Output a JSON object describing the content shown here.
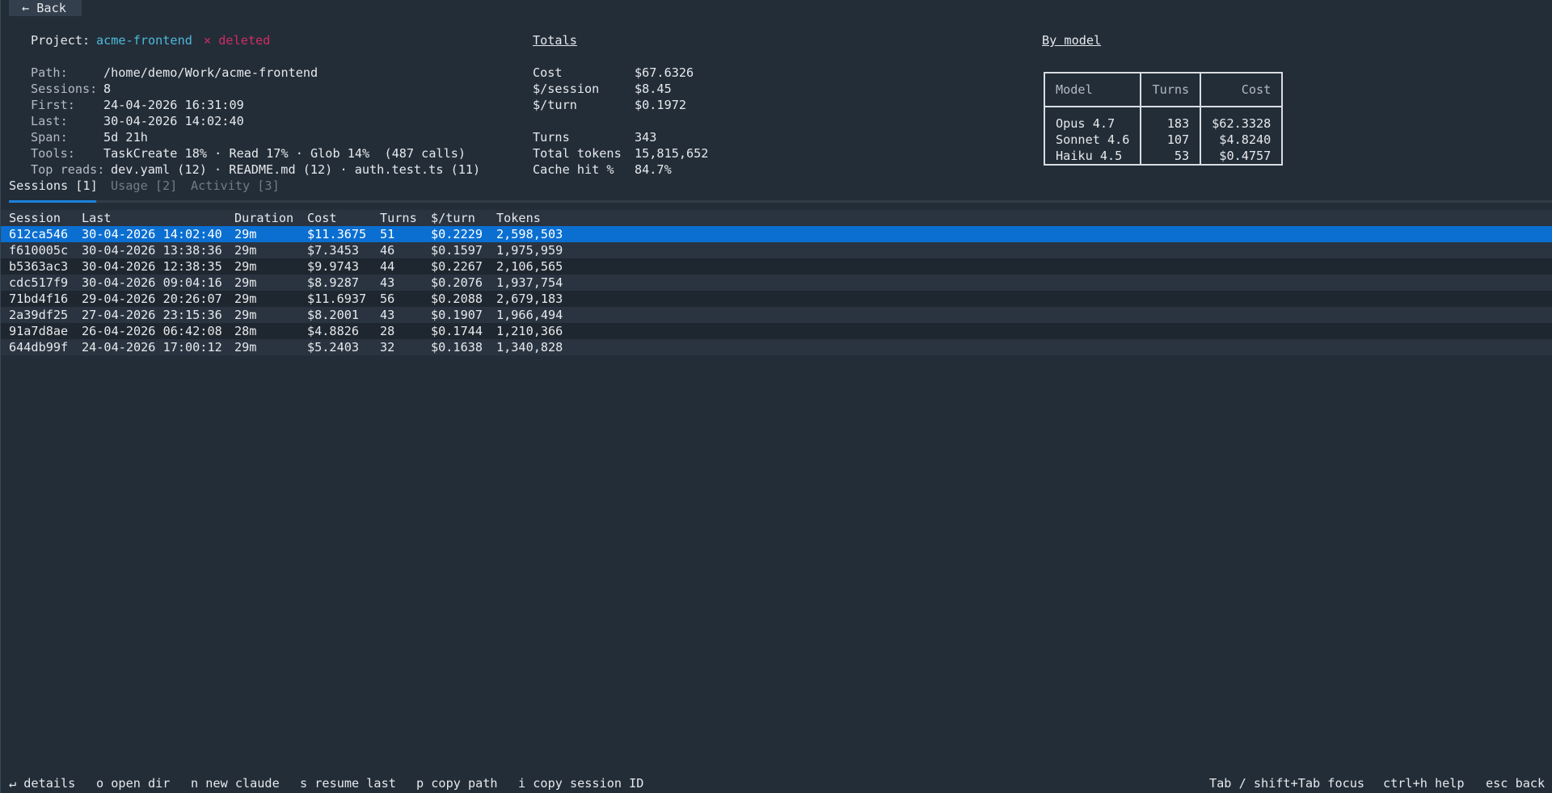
{
  "back_label": "← Back",
  "project": {
    "label": "Project:",
    "name": "acme-frontend",
    "status": "× deleted",
    "fields": [
      {
        "label": "Path:",
        "value": "/home/demo/Work/acme-frontend"
      },
      {
        "label": "Sessions:",
        "value": "8"
      },
      {
        "label": "First:",
        "value": "24-04-2026 16:31:09"
      },
      {
        "label": "Last:",
        "value": "30-04-2026 14:02:40"
      },
      {
        "label": "Span:",
        "value": "5d 21h"
      },
      {
        "label": "Tools:",
        "value": "TaskCreate 18% · Read 17% · Glob 14%  (487 calls)"
      },
      {
        "label": "Top reads:",
        "value": "dev.yaml (12) · README.md (12) · auth.test.ts (11)"
      }
    ]
  },
  "totals": {
    "title": "Totals",
    "rows": [
      {
        "label": "Cost",
        "value": "$67.6326"
      },
      {
        "label": "$/session",
        "value": "$8.45"
      },
      {
        "label": "$/turn",
        "value": "$0.1972"
      },
      {
        "label": "Turns",
        "value": "343"
      },
      {
        "label": "Total tokens",
        "value": "15,815,652"
      },
      {
        "label": "Cache hit %",
        "value": "84.7%"
      }
    ]
  },
  "by_model": {
    "title": "By model",
    "headers": [
      "Model",
      "Turns",
      "Cost"
    ],
    "rows": [
      [
        "Opus 4.7",
        "183",
        "$62.3328"
      ],
      [
        "Sonnet 4.6",
        "107",
        "$4.8240"
      ],
      [
        "Haiku 4.5",
        "53",
        "$0.4757"
      ]
    ]
  },
  "tabs": [
    "Sessions [1]",
    "Usage [2]",
    "Activity [3]"
  ],
  "sessions": {
    "headers": [
      "Session",
      "Last",
      "Duration",
      "Cost",
      "Turns",
      "$/turn",
      "Tokens"
    ],
    "rows": [
      [
        "612ca546",
        "30-04-2026 14:02:40",
        "29m",
        "$11.3675",
        "51",
        "$0.2229",
        "2,598,503"
      ],
      [
        "f610005c",
        "30-04-2026 13:38:36",
        "29m",
        "$7.3453",
        "46",
        "$0.1597",
        "1,975,959"
      ],
      [
        "b5363ac3",
        "30-04-2026 12:38:35",
        "29m",
        "$9.9743",
        "44",
        "$0.2267",
        "2,106,565"
      ],
      [
        "cdc517f9",
        "30-04-2026 09:04:16",
        "29m",
        "$8.9287",
        "43",
        "$0.2076",
        "1,937,754"
      ],
      [
        "71bd4f16",
        "29-04-2026 20:26:07",
        "29m",
        "$11.6937",
        "56",
        "$0.2088",
        "2,679,183"
      ],
      [
        "2a39df25",
        "27-04-2026 23:15:36",
        "29m",
        "$8.2001",
        "43",
        "$0.1907",
        "1,966,494"
      ],
      [
        "91a7d8ae",
        "26-04-2026 06:42:08",
        "28m",
        "$4.8826",
        "28",
        "$0.1744",
        "1,210,366"
      ],
      [
        "644db99f",
        "24-04-2026 17:00:12",
        "29m",
        "$5.2403",
        "32",
        "$0.1638",
        "1,340,828"
      ]
    ]
  },
  "footer": {
    "left": [
      "↵ details",
      "o open dir",
      "n new claude",
      "s resume last",
      "p copy path",
      "i copy session ID"
    ],
    "right": [
      "Tab / shift+Tab focus",
      "ctrl+h help",
      "esc back"
    ]
  }
}
